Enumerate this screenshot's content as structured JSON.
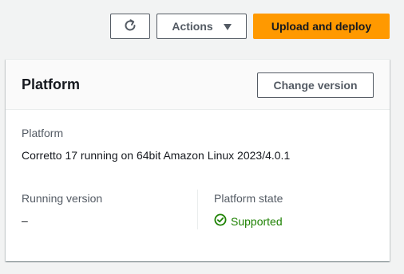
{
  "toolbar": {
    "refresh_icon": "refresh-icon",
    "actions_label": "Actions",
    "upload_deploy_label": "Upload and deploy",
    "primary_color": "#ff9900"
  },
  "panel": {
    "title": "Platform",
    "change_version_label": "Change version",
    "platform": {
      "label": "Platform",
      "value": "Corretto 17 running on 64bit Amazon Linux 2023/4.0.1"
    },
    "running_version": {
      "label": "Running version",
      "value": "–"
    },
    "platform_state": {
      "label": "Platform state",
      "value": "Supported",
      "icon": "check-circle-icon",
      "color": "#1d8102"
    }
  }
}
